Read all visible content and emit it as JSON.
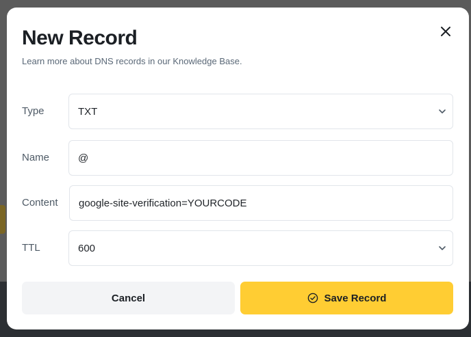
{
  "modal": {
    "title": "New Record",
    "subtitle": "Learn more about DNS records in our Knowledge Base."
  },
  "fields": {
    "type": {
      "label": "Type",
      "value": "TXT"
    },
    "name": {
      "label": "Name",
      "value": "@"
    },
    "content": {
      "label": "Content",
      "value": "google-site-verification=YOURCODE"
    },
    "ttl": {
      "label": "TTL",
      "value": "600"
    }
  },
  "actions": {
    "cancel_label": "Cancel",
    "save_label": "Save Record"
  },
  "icons": {
    "close": "close-icon",
    "dropdown": "chevron-down-icon",
    "save": "check-circle-icon"
  },
  "colors": {
    "accent": "#ffcd33",
    "cancel_bg": "#f3f4f6",
    "title": "#1b1f24",
    "muted": "#5a6877"
  }
}
